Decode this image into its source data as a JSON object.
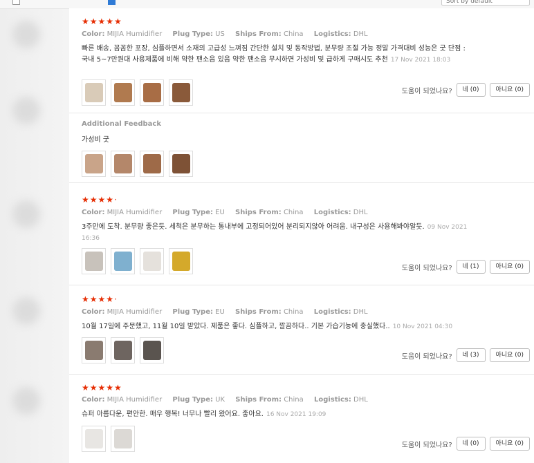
{
  "topbar": {
    "sort_label": "Sort by default"
  },
  "helpful_label": "도움이 되었나요?",
  "meta_labels": {
    "color": "Color:",
    "plug": "Plug Type:",
    "ships": "Ships From:",
    "logistics": "Logistics:"
  },
  "colors": {
    "star": "#e62e04",
    "accent": "#2f7bd6"
  },
  "reviews": [
    {
      "stars": "★★★★★",
      "color": "MIJIA Humidifier",
      "plug": "US",
      "ships": "China",
      "logistics": "DHL",
      "text": "빠른 배송, 꼼꼼한 포장, 심플하면서 소재의 고급성 느껴짐 간단한 설치 및 동작방법, 분무량 조절 가능 정말 가격대비 성능은 굿 단점 : 국내 5~7만원대 사용제품에 비해 약한 팬소음 있음 약한 팬소음 무시하면 가성비 및 급하게 구매시도 추천",
      "date": "17 Nov 2021 18:03",
      "yes": "네 (0)",
      "no": "아니요 (0)",
      "additional_title": "Additional Feedback",
      "additional_text": "가성비 굿"
    },
    {
      "stars": "★★★★·",
      "color": "MIJIA Humidifier",
      "plug": "EU",
      "ships": "China",
      "logistics": "DHL",
      "text": "3주만에 도착. 분무량 좋은듯. 세척은 분무하는 통내부에 고정되어있어 분리되지않아 어려움. 내구성은 사용해봐야알듯.",
      "date": "09 Nov 2021 16:36",
      "yes": "네 (1)",
      "no": "아니요 (0)"
    },
    {
      "stars": "★★★★·",
      "color": "MIJIA Humidifier",
      "plug": "EU",
      "ships": "China",
      "logistics": "DHL",
      "text": "10월 17일에 주문했고, 11월 10일 받았다. 제품은 좋다. 심플하고, 깔끔하다.. 기본 가습기능에 충실했다..",
      "date": "10 Nov 2021 04:30",
      "yes": "네 (3)",
      "no": "아니요 (0)"
    },
    {
      "stars": "★★★★★",
      "color": "MIJIA Humidifier",
      "plug": "UK",
      "ships": "China",
      "logistics": "DHL",
      "text": "슈퍼 아름다운, 편안한. 매우 행복! 너무나 빨리 왔어요. 좋아요.",
      "date": "16 Nov 2021 19:09",
      "yes": "네 (0)",
      "no": "아니요 (0)"
    }
  ]
}
